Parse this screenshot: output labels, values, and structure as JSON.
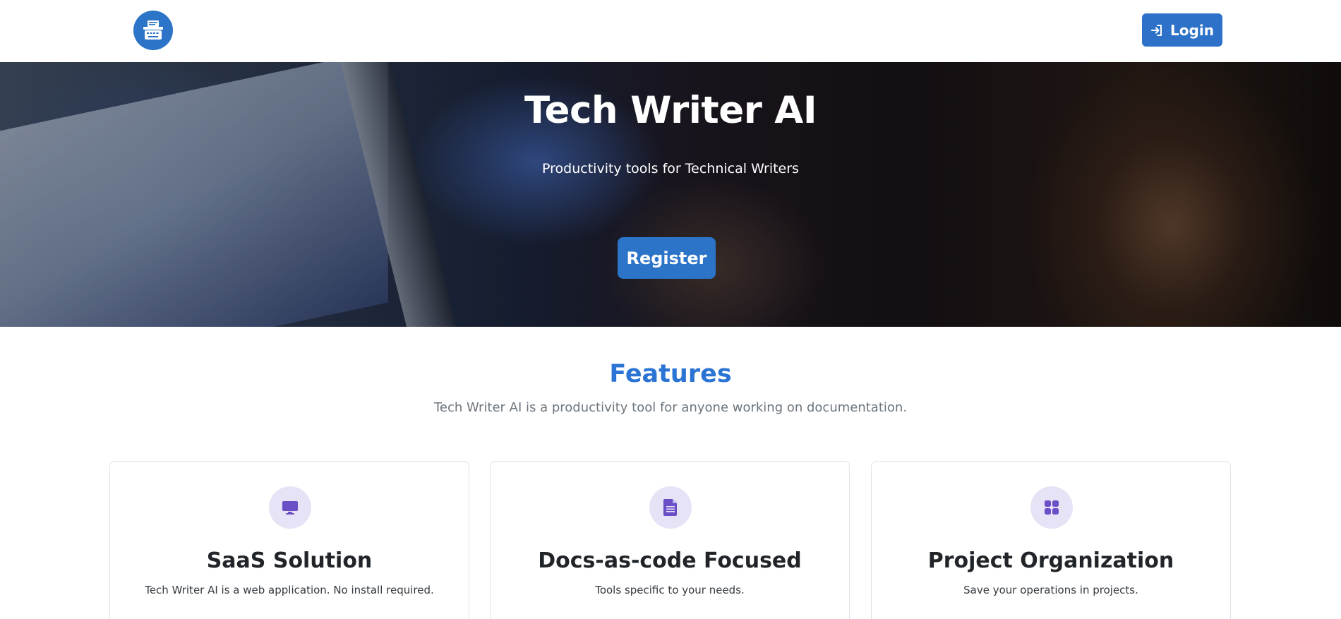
{
  "navbar": {
    "logo_icon": "typewriter-icon",
    "login_label": "Login",
    "login_icon": "sign-in-icon"
  },
  "hero": {
    "title": "Tech Writer AI",
    "subtitle": "Productivity tools for Technical Writers",
    "register_label": "Register"
  },
  "features": {
    "title": "Features",
    "subtitle": "Tech Writer AI is a productivity tool for anyone working on documentation.",
    "cards": [
      {
        "icon": "monitor-icon",
        "title": "SaaS Solution",
        "text": "Tech Writer AI is a web application. No install required."
      },
      {
        "icon": "document-icon",
        "title": "Docs-as-code Focused",
        "text": "Tools specific to your needs."
      },
      {
        "icon": "grid-icon",
        "title": "Project Organization",
        "text": "Save your operations in projects."
      }
    ]
  },
  "colors": {
    "primary": "#2b74c8",
    "features_title": "#2b74d4",
    "icon_circle": "#e7e3f6",
    "icon_glyph": "#6a4fc7"
  }
}
